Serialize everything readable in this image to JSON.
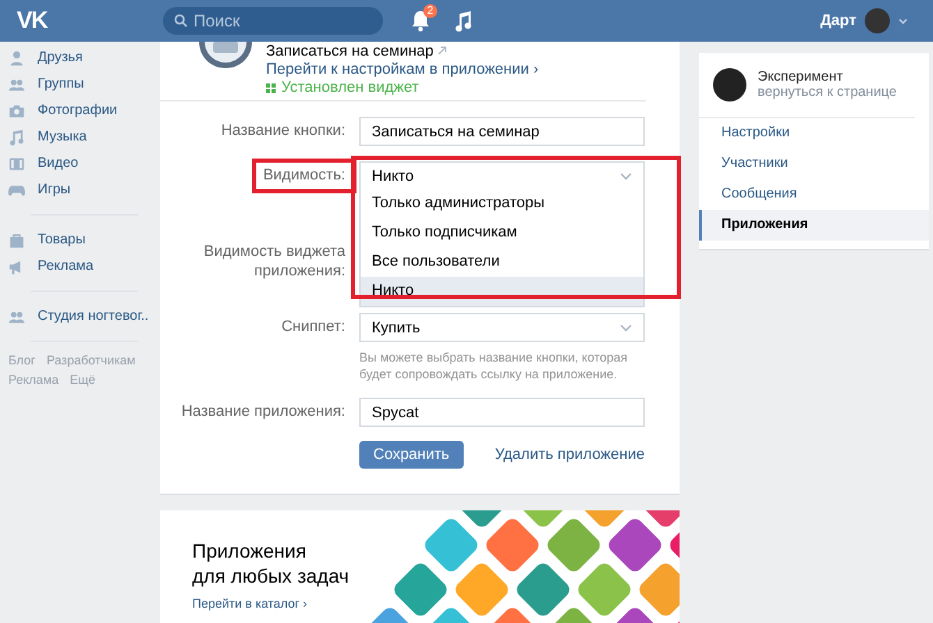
{
  "header": {
    "logo": "VK",
    "search_placeholder": "Поиск",
    "notification_count": "2",
    "user_name": "Дарт"
  },
  "sidebar": {
    "groups": [
      [
        {
          "label": "Друзья",
          "kind": "person"
        },
        {
          "label": "Группы",
          "kind": "people"
        },
        {
          "label": "Фотографии",
          "kind": "camera"
        },
        {
          "label": "Музыка",
          "kind": "note"
        },
        {
          "label": "Видео",
          "kind": "video"
        },
        {
          "label": "Игры",
          "kind": "gamepad"
        }
      ],
      [
        {
          "label": "Товары",
          "kind": "bag"
        },
        {
          "label": "Реклама",
          "kind": "megaphone"
        }
      ],
      [
        {
          "label": "Студия ногтевог..",
          "kind": "people"
        }
      ]
    ],
    "footer_links": [
      "Блог",
      "Разработчикам",
      "Реклама",
      "Ещё"
    ]
  },
  "app_info": {
    "button_title": "Записаться на семинар",
    "settings_link": "Перейти к настройкам в приложении ›",
    "widget_status": "Установлен виджет"
  },
  "form": {
    "rows": [
      {
        "kind": "text",
        "label": "Название кнопки:",
        "value": "Записаться на семинар"
      },
      {
        "kind": "select",
        "label": "Видимость:",
        "value": "Никто",
        "highlighted": true,
        "expanded": true,
        "options": [
          {
            "label": "Только администраторы",
            "selected": false
          },
          {
            "label": "Только подписчикам",
            "selected": false
          },
          {
            "label": "Все пользователи",
            "selected": false
          },
          {
            "label": "Никто",
            "selected": true
          }
        ]
      },
      {
        "kind": "covered",
        "label": "Видимость виджета приложения:"
      },
      {
        "kind": "select",
        "label": "Сниппет:",
        "value": "Купить",
        "hint": "Вы можете выбрать название кнопки, которая будет сопровождать ссылку на приложение."
      },
      {
        "kind": "text",
        "label": "Название приложения:",
        "value": "Spycat"
      }
    ],
    "save_button": "Сохранить",
    "delete_link": "Удалить приложение"
  },
  "promo": {
    "title": "Приложения\nдля любых задач",
    "catalog_link": "Перейти в каталог ›"
  },
  "community": {
    "name": "Эксперимент",
    "subtitle": "вернуться к странице",
    "menu": [
      {
        "label": "Настройки",
        "selected": false
      },
      {
        "label": "Участники",
        "selected": false
      },
      {
        "label": "Сообщения",
        "selected": false
      },
      {
        "label": "Приложения",
        "selected": true
      }
    ]
  }
}
